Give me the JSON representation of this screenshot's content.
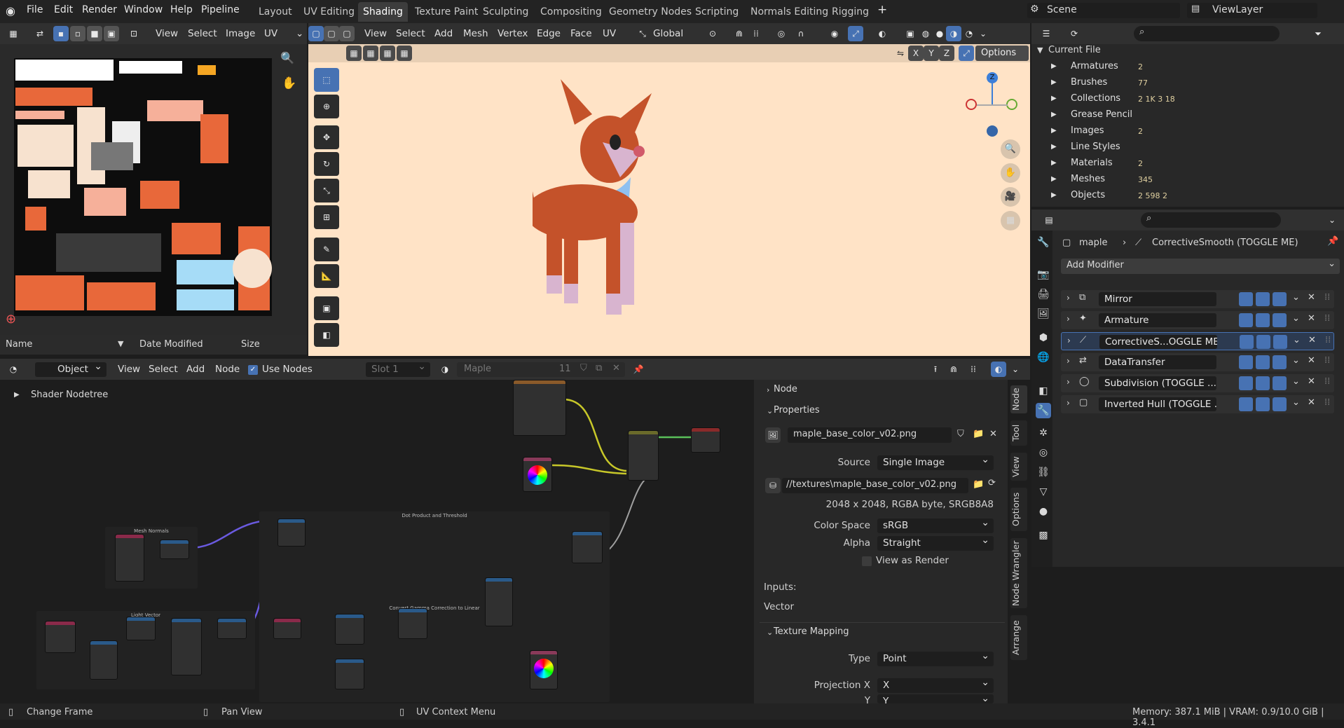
{
  "menu": {
    "file": "File",
    "edit": "Edit",
    "render": "Render",
    "window": "Window",
    "help": "Help",
    "pipeline": "Pipeline"
  },
  "workspaces": [
    "Layout",
    "UV Editing",
    "Shading",
    "Texture Paint",
    "Sculpting",
    "Compositing",
    "Geometry Nodes",
    "Scripting",
    "Normals Editing",
    "Rigging"
  ],
  "active_workspace": "Shading",
  "scene": "Scene",
  "view_layer": "ViewLayer",
  "image_editor": {
    "menus": [
      "View",
      "Select",
      "Image",
      "UV"
    ]
  },
  "viewport": {
    "menus": [
      "View",
      "Select",
      "Add",
      "Mesh",
      "Vertex",
      "Edge",
      "Face",
      "UV"
    ],
    "orientation": "Global",
    "options": "Options",
    "axes": [
      "X",
      "Y",
      "Z"
    ],
    "gizmo": {
      "z": "Z"
    }
  },
  "file_browser": {
    "col_name": "Name",
    "col_date": "Date Modified",
    "col_size": "Size"
  },
  "outliner": {
    "root": "Current File",
    "rows": [
      {
        "label": "Armatures",
        "count": "2"
      },
      {
        "label": "Brushes",
        "count": "77"
      },
      {
        "label": "Collections",
        "count": "2  1K  3  18"
      },
      {
        "label": "Grease Pencil",
        "count": ""
      },
      {
        "label": "Images",
        "count": "2"
      },
      {
        "label": "Line Styles",
        "count": ""
      },
      {
        "label": "Materials",
        "count": "2"
      },
      {
        "label": "Meshes",
        "count": "345"
      },
      {
        "label": "Objects",
        "count": "2  598  2"
      }
    ]
  },
  "properties": {
    "object": "maple",
    "modifier": "CorrectiveSmooth (TOGGLE ME)",
    "add_modifier": "Add Modifier",
    "modifiers": [
      "Mirror",
      "Armature",
      "CorrectiveS...OGGLE ME)",
      "DataTransfer",
      "Subdivision (TOGGLE ...",
      "Inverted Hull (TOGGLE ..."
    ]
  },
  "node_editor": {
    "mode": "Object",
    "menus": [
      "View",
      "Select",
      "Add",
      "Node"
    ],
    "use_nodes": "Use Nodes",
    "slot": "Slot 1",
    "material": "Maple",
    "users": "11",
    "breadcrumb": "Shader Nodetree",
    "frames": [
      "Mesh Normals",
      "Dot Product and Threshold",
      "Light Vector",
      "Convert Gamma Correction to Linear"
    ]
  },
  "node_panel": {
    "node": "Node",
    "properties": "Properties",
    "image": "maple_base_color_v02.png",
    "source_label": "Source",
    "source": "Single Image",
    "filepath": "//textures\\maple_base_color_v02.png",
    "info": "2048 x 2048,  RGBA byte,  SRGB8A8",
    "color_space_label": "Color Space",
    "color_space": "sRGB",
    "alpha_label": "Alpha",
    "alpha": "Straight",
    "view_as_render": "View as Render",
    "inputs": "Inputs:",
    "vector": "Vector",
    "texture_mapping": "Texture Mapping",
    "type_label": "Type",
    "type": "Point",
    "proj_x_label": "Projection X",
    "proj_x": "X",
    "proj_y_label": "Y",
    "proj_y": "Y"
  },
  "side_tabs": [
    "Node",
    "Tool",
    "View",
    "Options",
    "Node Wrangler",
    "Arrange"
  ],
  "status": {
    "change_frame": "Change Frame",
    "pan_view": "Pan View",
    "uv_menu": "UV Context Menu",
    "memory": "Memory: 387.1 MiB | VRAM: 0.9/10.0 GiB | 3.4.1"
  },
  "colors": {
    "accent": "#4772b3",
    "viewport_bg": "#ffe3c6",
    "dog": "#c4522a"
  }
}
